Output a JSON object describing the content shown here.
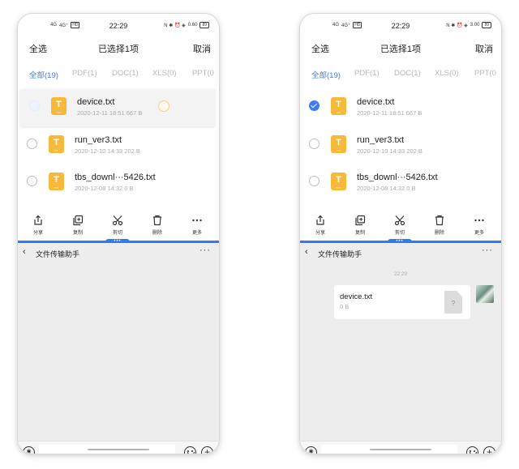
{
  "status_bar": {
    "signal_left": "4G",
    "signal_right": "4G⁺",
    "hd_badge": "HD",
    "time": "22:29",
    "icons": "N ✱ ⏰ ◈",
    "speed_left": "0.60",
    "speed_right": "3.00",
    "battery": "89"
  },
  "header": {
    "select_all": "全选",
    "title": "已选择1项",
    "cancel": "取消"
  },
  "tabs": [
    {
      "label": "全部(19)"
    },
    {
      "label": "PDF(1)"
    },
    {
      "label": "DOC(1)"
    },
    {
      "label": "XLS(0)"
    },
    {
      "label": "PPT(0"
    }
  ],
  "files": [
    {
      "name": "device.txt",
      "meta": "2020-12-11 18:51   667 B",
      "icon_letter": "T",
      "icon_sub": "TXT"
    },
    {
      "name": "run_ver3.txt",
      "meta": "2020-12-10 14:33   202 B",
      "icon_letter": "T",
      "icon_sub": "TXT"
    },
    {
      "name": "tbs_downl···5426.txt",
      "meta": "2020-12-08 14:32   0 B",
      "icon_letter": "T",
      "icon_sub": "TXT"
    }
  ],
  "actions": [
    {
      "label": "分享",
      "icon": "share-icon"
    },
    {
      "label": "复制",
      "icon": "copy-icon"
    },
    {
      "label": "剪切",
      "icon": "scissors-icon"
    },
    {
      "label": "删除",
      "icon": "trash-icon"
    },
    {
      "label": "更多",
      "icon": "more-icon"
    }
  ],
  "divider_handle": "•••",
  "chat": {
    "back": "‹",
    "title": "文件传输助手",
    "more": "···",
    "time": "22:29",
    "message": {
      "file_name": "device.txt",
      "file_size": "0 B",
      "file_icon": "?"
    }
  },
  "input_bar": {
    "voice": "◉",
    "plus": "+"
  },
  "colors": {
    "accent": "#3d7cf2",
    "divider": "#2e7cf0",
    "file_icon": "#f6b93b",
    "chat_bg": "#ededed"
  }
}
